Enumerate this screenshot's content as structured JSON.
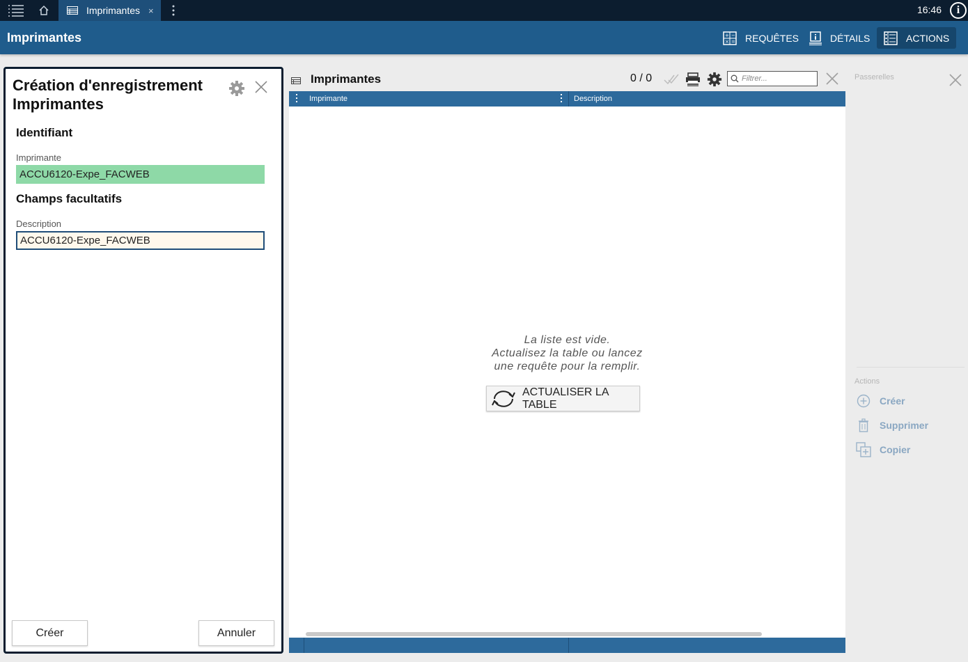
{
  "topbar": {
    "tab_label": "Imprimantes",
    "tab_close": "×",
    "time": "16:46",
    "info_glyph": "i"
  },
  "header": {
    "title": "Imprimantes",
    "buttons": [
      {
        "label": "REQUÊTES",
        "icon": "query-icon"
      },
      {
        "label": "DÉTAILS",
        "icon": "details-icon"
      },
      {
        "label": "ACTIONS",
        "icon": "actions-icon",
        "active": true
      }
    ]
  },
  "form": {
    "title": "Création d'enregistrement Imprimantes",
    "section_identifier": "Identifiant",
    "printer_label": "Imprimante",
    "printer_value": "ACCU6120-Expe_FACWEB",
    "section_optional": "Champs facultatifs",
    "description_label": "Description",
    "description_value": "ACCU6120-Expe_FACWEB",
    "create_label": "Créer",
    "cancel_label": "Annuler"
  },
  "list": {
    "title": "Imprimantes",
    "count": "0 / 0",
    "filter_placeholder": "Filtrer...",
    "columns": [
      "Imprimante",
      "Description"
    ],
    "empty_line1": "La liste est vide.",
    "empty_line2": "Actualisez la table ou lancez",
    "empty_line3": "une requête pour la remplir.",
    "refresh_label": "ACTUALISER LA TABLE"
  },
  "side": {
    "gateways_label": "Passerelles",
    "actions_label": "Actions",
    "actions": [
      "Créer",
      "Supprimer",
      "Copier"
    ]
  },
  "colors": {
    "topbar": "#0c1d2f",
    "header": "#1f5c8c",
    "tab_active": "#1e4f7a",
    "column_header": "#2d6a9c",
    "valid_field": "#8ed9a7",
    "action_text": "#8aa7c2"
  }
}
